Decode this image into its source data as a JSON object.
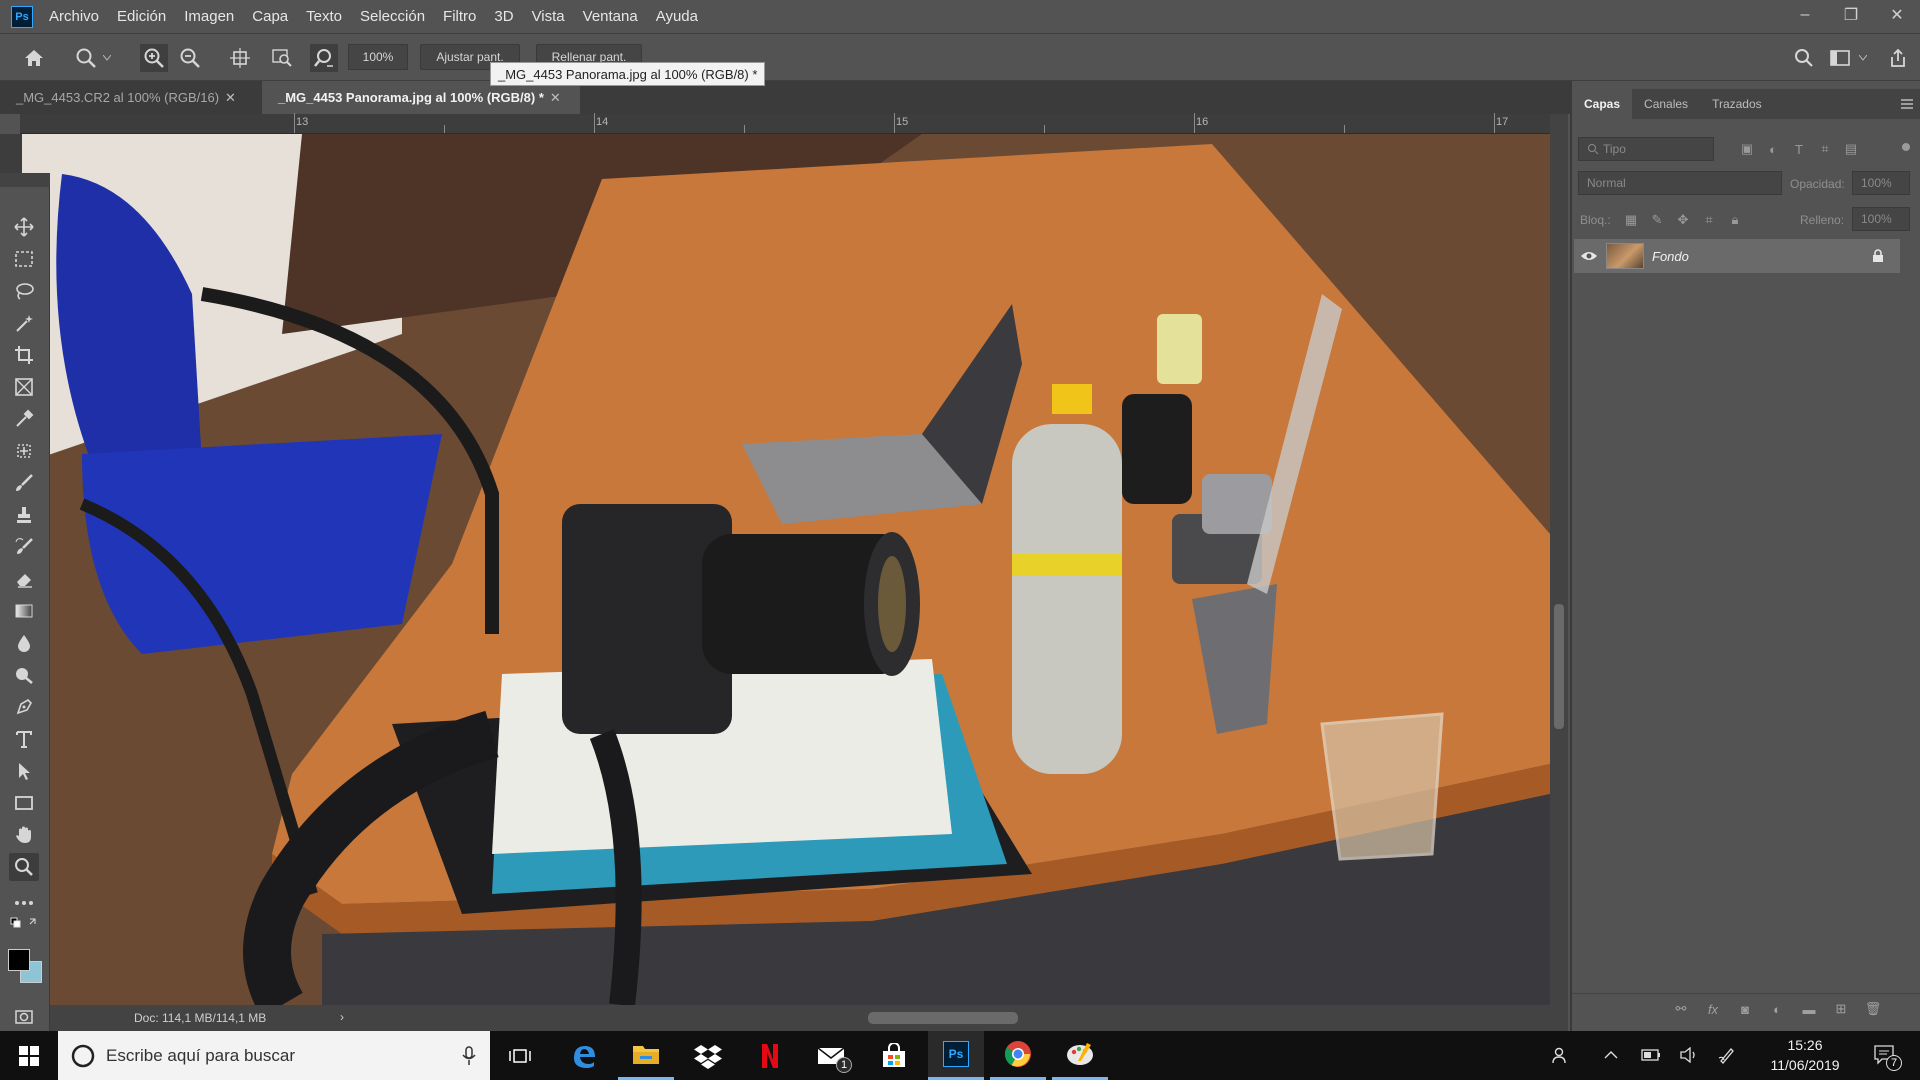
{
  "app": {
    "logo": "Ps"
  },
  "menu": [
    "Archivo",
    "Edición",
    "Imagen",
    "Capa",
    "Texto",
    "Selección",
    "Filtro",
    "3D",
    "Vista",
    "Ventana",
    "Ayuda"
  ],
  "window_controls": {
    "minimize": "–",
    "restore": "❐",
    "close": "✕"
  },
  "options": {
    "zoom_value": "100%",
    "fit_screen": "Ajustar pant.",
    "fill_screen": "Rellenar pant."
  },
  "tooltip": "_MG_4453 Panorama.jpg al 100% (RGB/8) *",
  "tabs": [
    {
      "label": "_MG_4453.CR2 al 100% (RGB/16)",
      "close": "✕"
    },
    {
      "label": "_MG_4453 Panorama.jpg al 100% (RGB/8) *",
      "close": "✕"
    }
  ],
  "ruler_labels": [
    "13",
    "14",
    "15",
    "16",
    "17"
  ],
  "status": {
    "doc_info": "Doc: 114,1 MB/114,1 MB",
    "arrow": "›"
  },
  "layers_panel": {
    "tabs": [
      "Capas",
      "Canales",
      "Trazados"
    ],
    "filter_placeholder": "Tipo",
    "blend_mode": "Normal",
    "opacity_label": "Opacidad:",
    "opacity_value": "100%",
    "lock_label": "Bloq.:",
    "fill_label": "Relleno:",
    "fill_value": "100%",
    "layers": [
      {
        "name": "Fondo",
        "visible": true,
        "locked": true
      }
    ]
  },
  "taskbar": {
    "search_placeholder": "Escribe aquí para buscar",
    "mail_badge": "1",
    "time": "15:26",
    "date": "11/06/2019",
    "notification_count": "7"
  },
  "colors": {
    "ui_bg": "#535353",
    "canvas_bg": "#282828",
    "taskbar_bg": "#101010",
    "ps_blue": "#31a8ff",
    "foreground_swatch": "#000000",
    "background_swatch": "#8fc3d6"
  }
}
